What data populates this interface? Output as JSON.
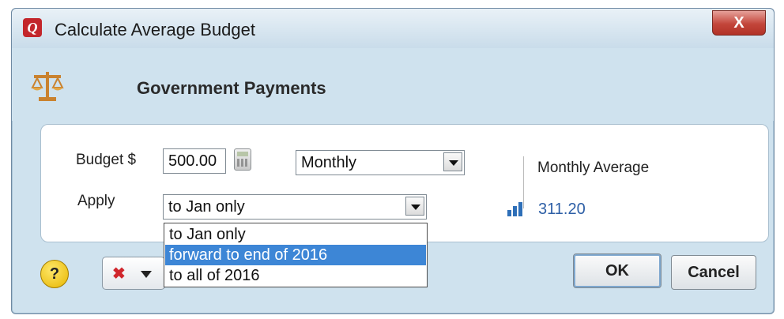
{
  "window": {
    "title": "Calculate Average Budget",
    "close_label": "X",
    "app_icon_letter": "Q"
  },
  "header": {
    "title": "Government Payments",
    "icon": "scales-icon"
  },
  "form": {
    "budget_label": "Budget $",
    "budget_value": "500.00",
    "period_value": "Monthly",
    "apply_label": "Apply",
    "apply_value": "to Jan only",
    "apply_options": [
      "to Jan only",
      "forward to end of 2016",
      "to all of 2016"
    ],
    "apply_highlighted_index": 1
  },
  "average": {
    "label": "Monthly Average",
    "value": "311.20",
    "icon": "bar-chart-icon"
  },
  "footer": {
    "help_label": "?",
    "ok_label": "OK",
    "cancel_label": "Cancel"
  },
  "colors": {
    "accent": "#3d86d6",
    "link": "#2d5fa6",
    "close": "#c3453a"
  }
}
